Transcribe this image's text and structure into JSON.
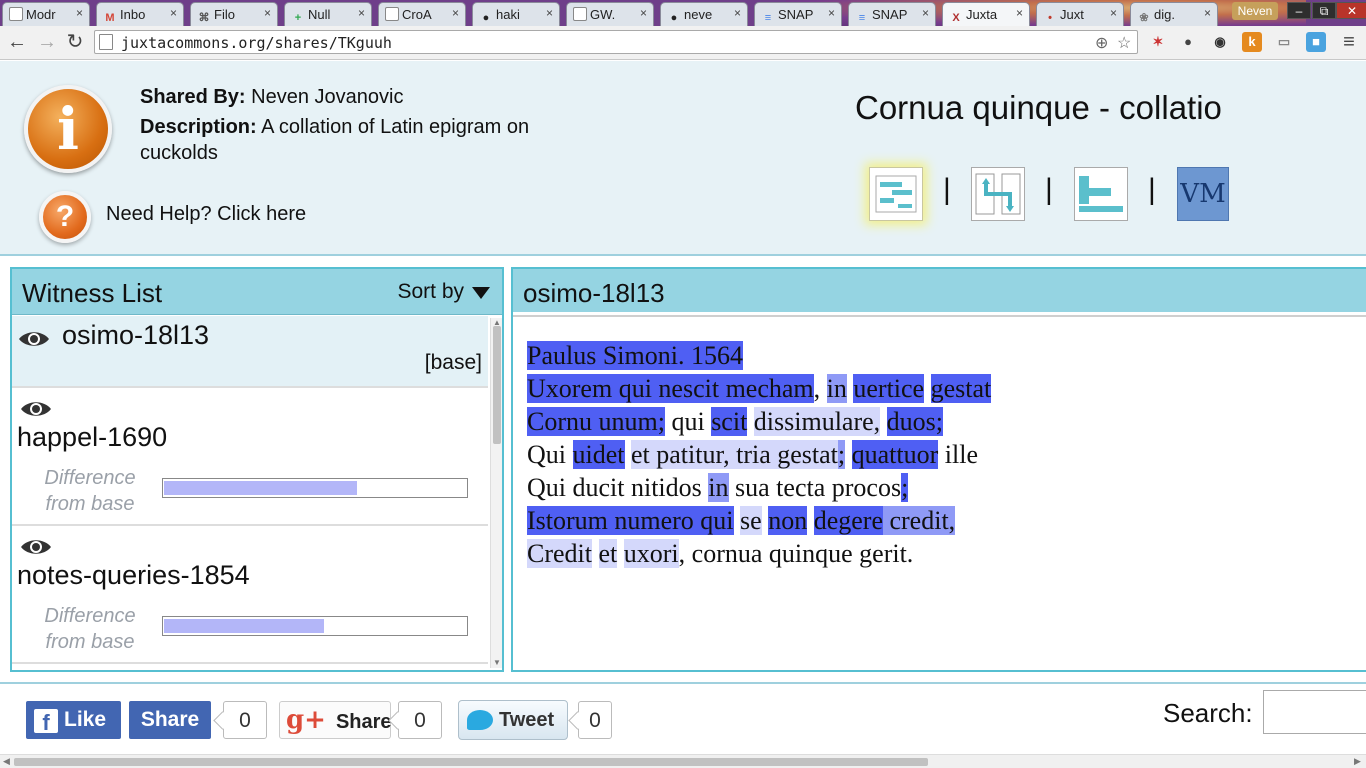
{
  "browser": {
    "tabs": [
      {
        "title": "Modr",
        "favicon": "page-icon",
        "favicon_char": "",
        "favicon_color": "#ffffff"
      },
      {
        "title": "Inbo",
        "favicon": "gmail-icon",
        "favicon_char": "M",
        "favicon_color": "#d44638"
      },
      {
        "title": "Filo",
        "favicon": "filo-icon",
        "favicon_char": "⌘",
        "favicon_color": "#555555"
      },
      {
        "title": "Null",
        "favicon": "plus-icon",
        "favicon_char": "+",
        "favicon_color": "#2fa84f"
      },
      {
        "title": "CroA",
        "favicon": "page-icon",
        "favicon_char": "",
        "favicon_color": "#ffffff"
      },
      {
        "title": "haki",
        "favicon": "github-icon",
        "favicon_char": "●",
        "favicon_color": "#222222"
      },
      {
        "title": "GW.",
        "favicon": "page-icon",
        "favicon_char": "",
        "favicon_color": "#ffffff"
      },
      {
        "title": "neve",
        "favicon": "github-icon",
        "favicon_char": "●",
        "favicon_color": "#222222"
      },
      {
        "title": "SNAP",
        "favicon": "docs-icon",
        "favicon_char": "≡",
        "favicon_color": "#4a86e8"
      },
      {
        "title": "SNAP",
        "favicon": "docs-icon",
        "favicon_char": "≡",
        "favicon_color": "#4a86e8"
      },
      {
        "title": "Juxta",
        "favicon": "juxta-icon",
        "favicon_char": "X",
        "favicon_color": "#b03030"
      },
      {
        "title": "Juxt",
        "favicon": "juxta-icon",
        "favicon_char": "•",
        "favicon_color": "#c0392b"
      },
      {
        "title": "dig.",
        "favicon": "dig-icon",
        "favicon_char": "❀",
        "favicon_color": "#777777"
      }
    ],
    "active_tab": 10,
    "user": "Neven",
    "url": "juxtacommons.org/shares/TKguuh"
  },
  "header": {
    "shared_by_label": "Shared By:",
    "shared_by": "Neven Jovanovic",
    "description_label": "Description:",
    "description": "A collation of Latin epigram on cuckolds",
    "help_text": "Need Help? Click here",
    "doc_title": "Cornua quinque - collatio",
    "separator": "|",
    "vm_label": "VM"
  },
  "witness_panel": {
    "title": "Witness List",
    "sort_label": "Sort by",
    "base_label": "[base]",
    "diff_label": "Difference from base",
    "witnesses": [
      {
        "name": "osimo-18l13",
        "is_base": true
      },
      {
        "name": "happel-1690",
        "difference": 0.64
      },
      {
        "name": "notes-queries-1854",
        "difference": 0.53
      }
    ]
  },
  "text_panel": {
    "title": "osimo-18l13",
    "lines": [
      [
        {
          "t": "Paulus Simoni. 1564",
          "h": 1
        }
      ],
      [
        {
          "t": "Uxorem qui nescit mecham",
          "h": 1
        },
        {
          "t": ", ",
          "h": 0
        },
        {
          "t": "in",
          "h": 2
        },
        {
          "t": " ",
          "h": 0
        },
        {
          "t": "uertice",
          "h": 1
        },
        {
          "t": " ",
          "h": 0
        },
        {
          "t": "gestat",
          "h": 1
        }
      ],
      [
        {
          "t": "Cornu unum;",
          "h": 1
        },
        {
          "t": " qui ",
          "h": 0
        },
        {
          "t": "scit",
          "h": 1
        },
        {
          "t": " ",
          "h": 0
        },
        {
          "t": "dissimulare,",
          "h": 3
        },
        {
          "t": " ",
          "h": 0
        },
        {
          "t": "duos;",
          "h": 1
        }
      ],
      [
        {
          "t": "Qui ",
          "h": 0
        },
        {
          "t": "uidet",
          "h": 1
        },
        {
          "t": " ",
          "h": 0
        },
        {
          "t": "et patitur, tria gestat",
          "h": 3
        },
        {
          "t": ";",
          "h": 2
        },
        {
          "t": " ",
          "h": 0
        },
        {
          "t": "quattuor",
          "h": 1
        },
        {
          "t": " ille",
          "h": 0
        }
      ],
      [
        {
          "t": "Qui ducit nitidos ",
          "h": 0
        },
        {
          "t": "in",
          "h": 2
        },
        {
          "t": " sua tecta procos",
          "h": 0
        },
        {
          "t": ";",
          "h": 1
        }
      ],
      [
        {
          "t": "Istorum numero qui",
          "h": 1
        },
        {
          "t": " ",
          "h": 0
        },
        {
          "t": "se",
          "h": 3
        },
        {
          "t": " ",
          "h": 0
        },
        {
          "t": "non",
          "h": 1
        },
        {
          "t": " ",
          "h": 0
        },
        {
          "t": "degere",
          "h": 1
        },
        {
          "t": " credit,",
          "h": 2
        }
      ],
      [
        {
          "t": "Credit",
          "h": 3
        },
        {
          "t": " ",
          "h": 0
        },
        {
          "t": "et",
          "h": 3
        },
        {
          "t": " ",
          "h": 0
        },
        {
          "t": "uxori",
          "h": 3
        },
        {
          "t": ", cornua quinque gerit.",
          "h": 0
        }
      ]
    ]
  },
  "footer": {
    "like_label": "Like",
    "fb_share_label": "Share",
    "fb_count": "0",
    "gplus_label": "Share",
    "gplus_count": "0",
    "tweet_label": "Tweet",
    "tweet_count": "0",
    "search_label": "Search:",
    "search_value": ""
  },
  "colors": {
    "header_bg": "#e7f2f6",
    "panel_header": "#95d4e2",
    "panel_border": "#56bfd1",
    "highlight_strong": "#4f5ff3",
    "highlight_medium": "#8f9af6",
    "highlight_light": "#d4d8fb",
    "diff_fill": "#b3b6f8",
    "facebook": "#4266b2"
  }
}
